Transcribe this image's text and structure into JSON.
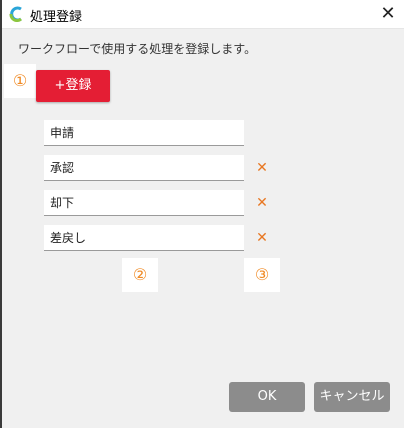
{
  "window": {
    "title": "処理登録",
    "close_glyph": "✕"
  },
  "description": "ワークフローで使用する処理を登録します。",
  "markers": [
    "①",
    "②",
    "③"
  ],
  "register_button": "+登録",
  "process_items": [
    "申請",
    "承認",
    "却下",
    "差戻し"
  ],
  "delete_glyph": "✕",
  "footer": {
    "ok_label": "OK",
    "cancel_label": "キャンセル"
  },
  "colors": {
    "accent_red": "#e41e34",
    "marker_orange": "#f08a24",
    "delete_orange": "#e87722"
  }
}
